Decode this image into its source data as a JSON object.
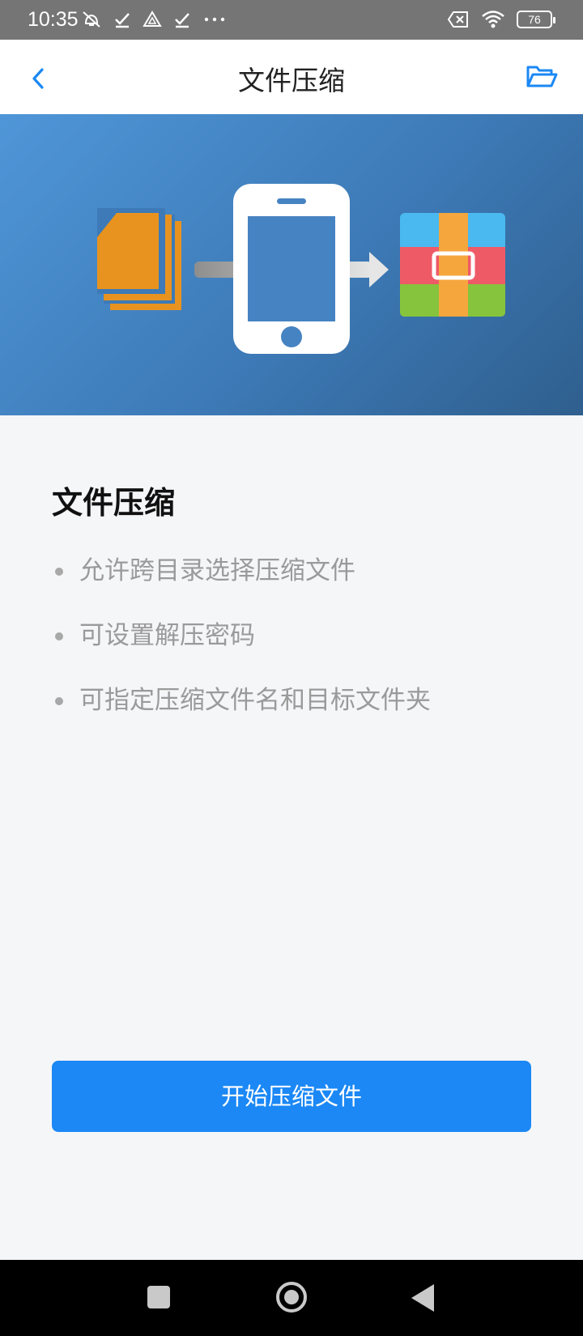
{
  "status_bar": {
    "time": "10:35",
    "battery": "76"
  },
  "header": {
    "title": "文件压缩"
  },
  "content": {
    "title": "文件压缩",
    "features": [
      "允许跨目录选择压缩文件",
      "可设置解压密码",
      "可指定压缩文件名和目标文件夹"
    ]
  },
  "actions": {
    "start_label": "开始压缩文件"
  },
  "icons": {
    "back": "back-arrow-icon",
    "folder": "open-folder-icon",
    "banner": [
      "files-icon",
      "phone-icon",
      "arrow-icon",
      "archive-icon"
    ]
  },
  "colors": {
    "accent": "#1b88f5",
    "banner_blue": "#3d7ab7",
    "files_orange": "#e8931f"
  }
}
